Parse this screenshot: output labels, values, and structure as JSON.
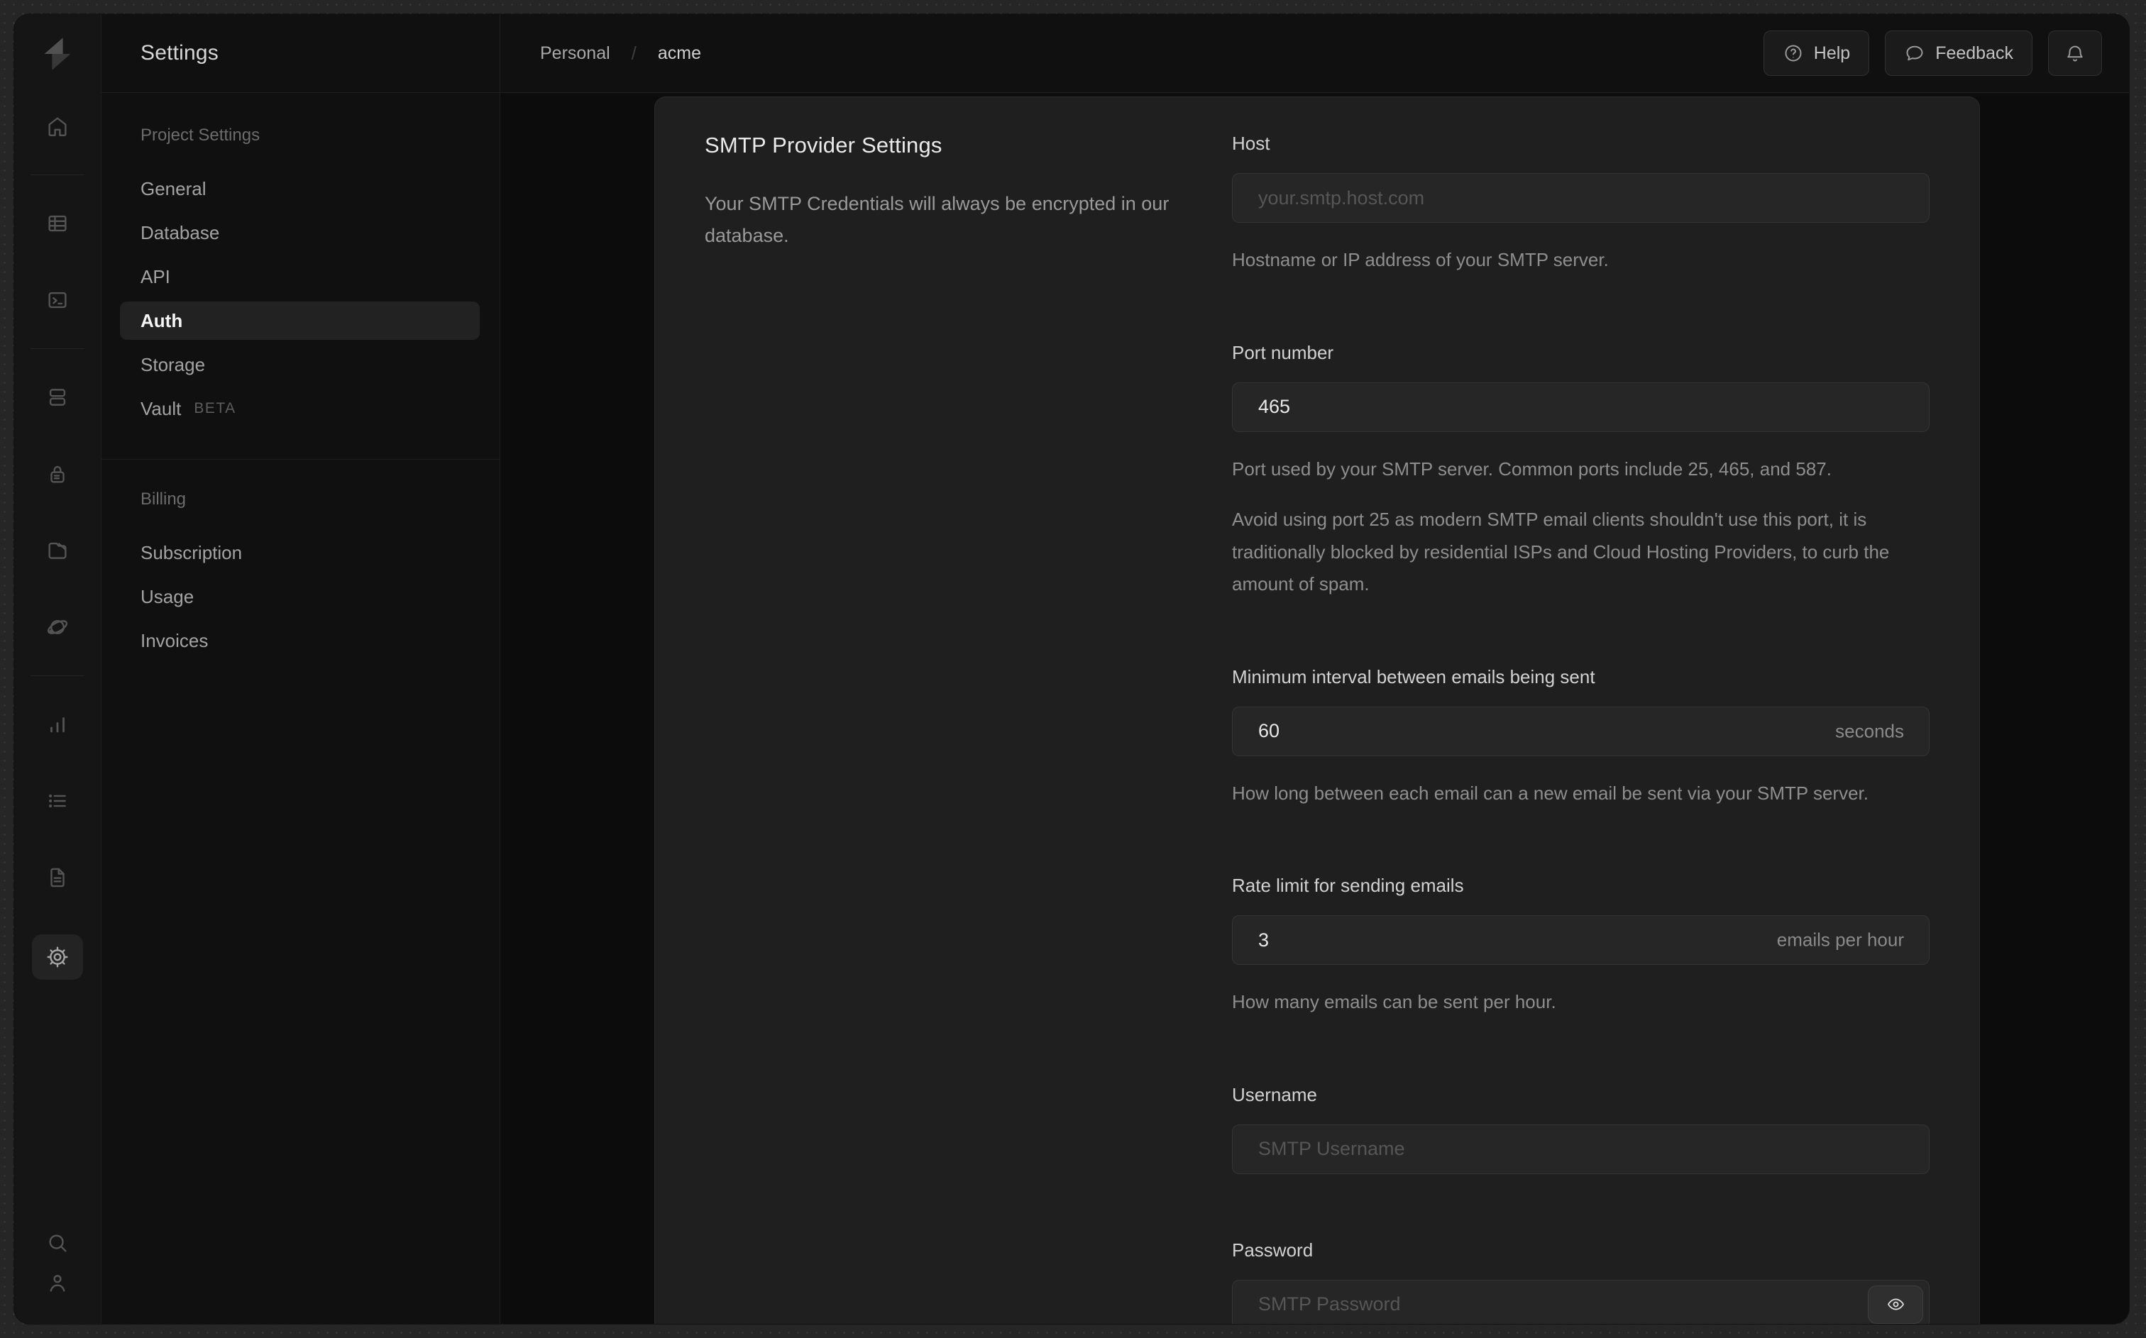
{
  "colors": {
    "backdrop": "#262626",
    "window_bg": "#101010",
    "card_bg": "#1f1f1f",
    "input_bg": "#262626",
    "text_primary": "#eaeaea",
    "text_muted": "#8e8e8e",
    "active_pill": "#222222"
  },
  "rail": {
    "icons": [
      "supabase-logo",
      "home",
      "table-editor",
      "sql-editor",
      "database",
      "auth",
      "storage",
      "edge-functions",
      "reports",
      "logs",
      "api-docs",
      "settings",
      "search",
      "user"
    ],
    "active_icon": "settings"
  },
  "sidebar": {
    "title": "Settings",
    "sections": [
      {
        "label": "Project Settings",
        "items": [
          {
            "label": "General"
          },
          {
            "label": "Database"
          },
          {
            "label": "API"
          },
          {
            "label": "Auth",
            "active": true
          },
          {
            "label": "Storage"
          },
          {
            "label": "Vault",
            "badge": "BETA"
          }
        ]
      },
      {
        "label": "Billing",
        "items": [
          {
            "label": "Subscription"
          },
          {
            "label": "Usage"
          },
          {
            "label": "Invoices"
          }
        ]
      }
    ]
  },
  "header": {
    "breadcrumb_org": "Personal",
    "breadcrumb_separator": "/",
    "breadcrumb_project": "acme",
    "help_label": "Help",
    "feedback_label": "Feedback"
  },
  "panel": {
    "title": "SMTP Provider Settings",
    "description": "Your SMTP Credentials will always be encrypted in our database.",
    "fields": [
      {
        "label": "Host",
        "placeholder": "your.smtp.host.com",
        "helpers": [
          "Hostname or IP address of your SMTP server."
        ]
      },
      {
        "label": "Port number",
        "value": "465",
        "helpers": [
          "Port used by your SMTP server. Common ports include 25, 465, and 587.",
          "Avoid using port 25 as modern SMTP email clients shouldn't use this port, it is traditionally blocked by residential ISPs and Cloud Hosting Providers, to curb the amount of spam."
        ]
      },
      {
        "label": "Minimum interval between emails being sent",
        "value": "60",
        "suffix": "seconds",
        "helpers": [
          "How long between each email can a new email be sent via your SMTP server."
        ]
      },
      {
        "label": "Rate limit for sending emails",
        "value": "3",
        "suffix": "emails per hour",
        "helpers": [
          "How many emails can be sent per hour."
        ]
      },
      {
        "label": "Username",
        "placeholder": "SMTP Username",
        "helpers": []
      },
      {
        "label": "Password",
        "placeholder": "SMTP Password",
        "helpers": []
      }
    ]
  }
}
